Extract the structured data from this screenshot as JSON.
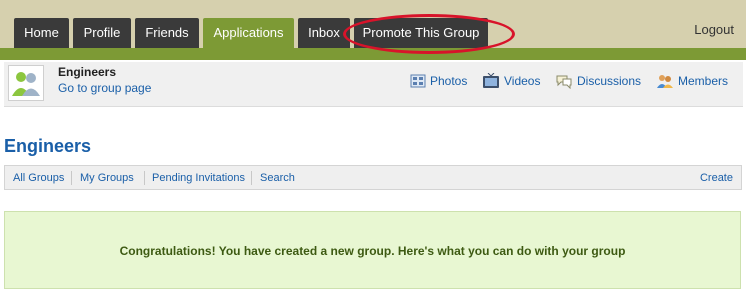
{
  "nav": {
    "tabs": [
      {
        "label": "Home"
      },
      {
        "label": "Profile"
      },
      {
        "label": "Friends"
      },
      {
        "label": "Applications"
      },
      {
        "label": "Inbox"
      },
      {
        "label": "Promote This Group"
      }
    ],
    "active_tab": "Applications",
    "logout": "Logout"
  },
  "group": {
    "name": "Engineers",
    "go_to_label": "Go to group page",
    "links": [
      {
        "label": "Photos",
        "icon": "photos-icon"
      },
      {
        "label": "Videos",
        "icon": "videos-icon"
      },
      {
        "label": "Discussions",
        "icon": "discussions-icon"
      },
      {
        "label": "Members",
        "icon": "members-icon"
      }
    ]
  },
  "page": {
    "title": "Engineers"
  },
  "subnav": {
    "items": [
      {
        "label": "All Groups"
      },
      {
        "label": "My Groups"
      },
      {
        "label": "Pending Invitations"
      },
      {
        "label": "Search"
      }
    ],
    "create": "Create"
  },
  "notice": {
    "message": "Congratulations! You have created a new group. Here's what you can do with your group"
  },
  "colors": {
    "nav_bg": "#d6d0ae",
    "tab_bg": "#3a3a3a",
    "active_tab": "#7d9a35",
    "link": "#1a5fa8",
    "highlight": "#d8132a",
    "notice_bg": "#e8f7d2"
  }
}
